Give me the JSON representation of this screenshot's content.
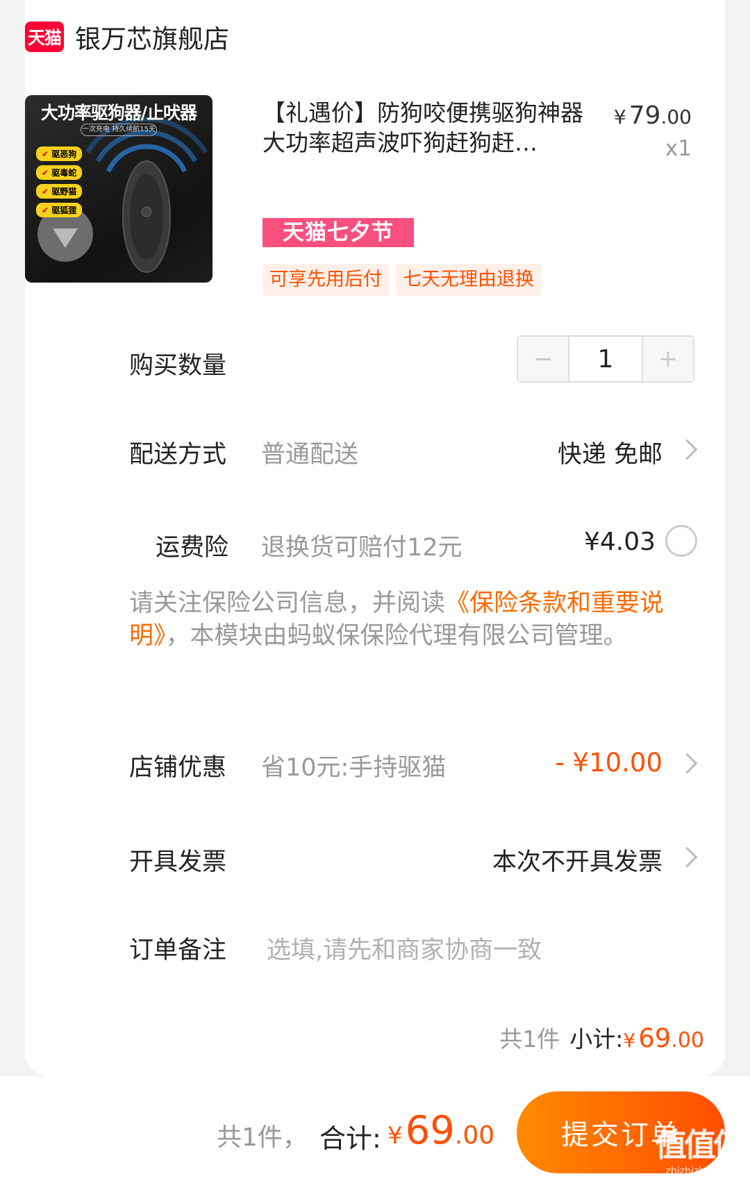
{
  "shop": {
    "logo_text": "天猫",
    "name": "银万芯旗舰店"
  },
  "product": {
    "image": {
      "title": "大功率驱狗器/止吠器",
      "subtitle": "一次充电 持久续航15天",
      "tags": [
        "驱恶狗",
        "驱毒蛇",
        "驱野猫",
        "驱狐狸"
      ]
    },
    "title": "【礼遇价】防狗咬便携驱狗神器大功率超声波吓狗赶狗赶…",
    "price_yen": "¥",
    "price_int": "79",
    "price_dec": ".00",
    "quantity": "x1",
    "festival_tag": "天猫七夕节",
    "tags": [
      "可享先用后付",
      "七天无理由退换"
    ]
  },
  "quantity_row": {
    "label": "购买数量",
    "minus": "−",
    "value": "1",
    "plus": "+"
  },
  "delivery": {
    "label": "配送方式",
    "value": "普通配送",
    "option": "快递 免邮"
  },
  "insurance": {
    "label": "运费险",
    "desc": "退换货可赔付12元",
    "price": "¥4.03",
    "selected": false
  },
  "notice": {
    "prefix": "请关注保险公司信息，并阅读",
    "link": "《保险条款和重要说明》",
    "suffix": "，本模块由蚂蚁保保险代理有限公司管理。"
  },
  "shop_discount": {
    "label": "店铺优惠",
    "desc": "省10元:手持驱猫",
    "amount": "- ¥10.00"
  },
  "invoice": {
    "label": "开具发票",
    "value": "本次不开具发票"
  },
  "remark": {
    "label": "订单备注",
    "placeholder": "选填,请先和商家协商一致"
  },
  "subtotal": {
    "count": "共1件",
    "label": "小计:",
    "yen": "¥",
    "int": "69",
    "dec": ".00"
  },
  "footer": {
    "count": "共1件，",
    "total_label": "合计:",
    "yen": "¥",
    "int": "69",
    "dec": ".00",
    "submit": "提交订单",
    "watermark": "值值值",
    "watermark_url": "zhizhizhi.com"
  },
  "colors": {
    "accent": "#ff5000",
    "festival": "#f94f7f",
    "tmall": "#ff0036"
  },
  "icons": [
    "tmall-logo",
    "chevron-right-icon",
    "radio-icon"
  ]
}
